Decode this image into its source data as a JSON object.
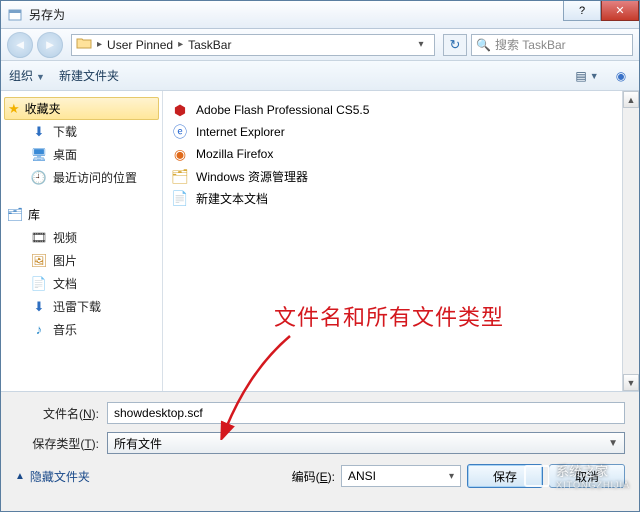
{
  "title": "另存为",
  "nav": {
    "breadcrumb": [
      "User Pinned",
      "TaskBar"
    ],
    "search_placeholder": "搜索 TaskBar"
  },
  "toolbar": {
    "organize": "组织",
    "new_folder": "新建文件夹"
  },
  "sidebar": {
    "favorites_label": "收藏夹",
    "favorites": [
      {
        "icon": "download-icon",
        "label": "下载"
      },
      {
        "icon": "desktop-icon",
        "label": "桌面"
      },
      {
        "icon": "recent-icon",
        "label": "最近访问的位置"
      }
    ],
    "libraries_label": "库",
    "libraries": [
      {
        "icon": "video-icon",
        "label": "视频"
      },
      {
        "icon": "pictures-icon",
        "label": "图片"
      },
      {
        "icon": "documents-icon",
        "label": "文档"
      },
      {
        "icon": "xunlei-icon",
        "label": "迅雷下载"
      },
      {
        "icon": "music-icon",
        "label": "音乐"
      }
    ]
  },
  "files": [
    {
      "icon": "flash-icon",
      "label": "Adobe Flash Professional CS5.5"
    },
    {
      "icon": "ie-icon",
      "label": "Internet Explorer"
    },
    {
      "icon": "firefox-icon",
      "label": "Mozilla Firefox"
    },
    {
      "icon": "explorer-icon",
      "label": "Windows 资源管理器"
    },
    {
      "icon": "textfile-icon",
      "label": "新建文本文档"
    }
  ],
  "bottom": {
    "filename_label": "文件名(N):",
    "filename_value": "showdesktop.scf",
    "filetype_label": "保存类型(T):",
    "filetype_value": "所有文件",
    "hide_folders": "隐藏文件夹",
    "encoding_label": "编码(E):",
    "encoding_value": "ANSI",
    "save_label": "保存",
    "cancel_label": "取消"
  },
  "annotation": "文件名和所有文件类型",
  "watermark": {
    "name": "系统之家",
    "sub": "XITONGZHIJIA"
  }
}
